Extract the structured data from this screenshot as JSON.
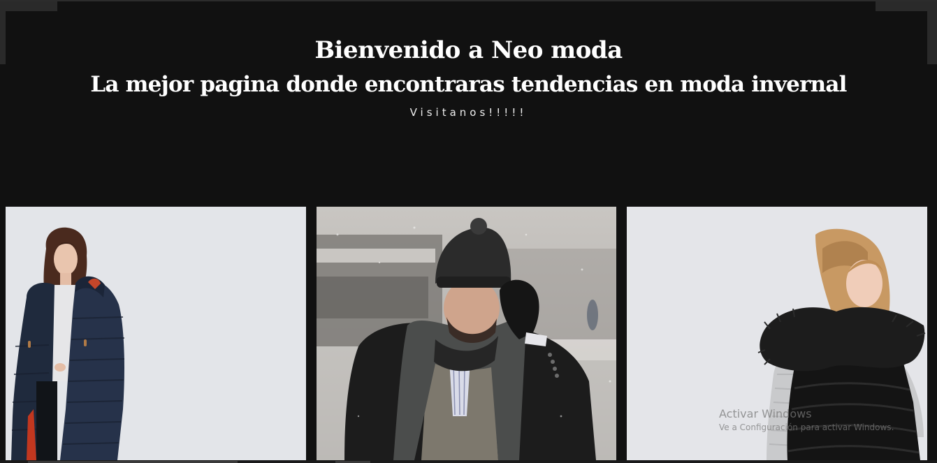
{
  "hero": {
    "title": "Bienvenido a Neo moda",
    "subtitle": "La mejor pagina donde encontraras tendencias en moda invernal",
    "cta": "Visitanos!!!!!"
  },
  "gallery": {
    "images": [
      {
        "name": "woman-navy-parka-photo"
      },
      {
        "name": "man-beanie-scarf-snow-photo"
      },
      {
        "name": "woman-fur-hood-vest-photo"
      }
    ]
  },
  "watermark": {
    "title": "Activar Windows",
    "subtitle": "Ve a Configuración para activar Windows."
  },
  "colors": {
    "background": "#111111",
    "text": "#ffffff"
  }
}
